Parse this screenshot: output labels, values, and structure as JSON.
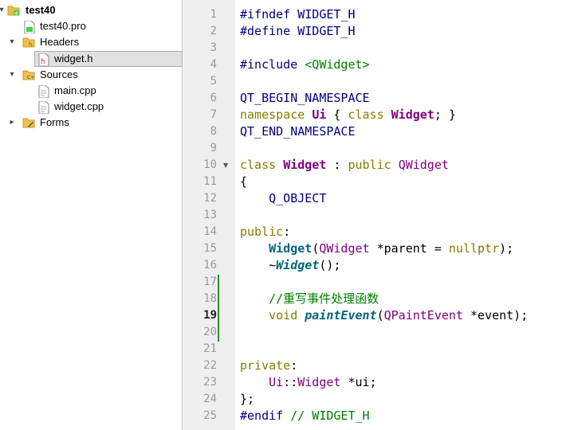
{
  "project_tree": {
    "root": {
      "label": "test40",
      "expanded": true
    },
    "items": [
      {
        "label": "test40.pro",
        "icon": "qt-project-file-icon"
      },
      {
        "label": "Headers",
        "icon": "headers-folder-icon",
        "expanded": true
      },
      {
        "label": "widget.h",
        "icon": "header-file-icon",
        "selected": true
      },
      {
        "label": "Sources",
        "icon": "sources-folder-icon",
        "expanded": true
      },
      {
        "label": "main.cpp",
        "icon": "cpp-file-icon"
      },
      {
        "label": "widget.cpp",
        "icon": "cpp-file-icon"
      },
      {
        "label": "Forms",
        "icon": "forms-folder-icon",
        "expanded": false
      }
    ]
  },
  "editor": {
    "current_line": 19,
    "folded_marker_line": 10,
    "lines": [
      {
        "n": "1",
        "tokens": [
          {
            "t": "#ifndef WIDGET_H",
            "c": "pre"
          }
        ]
      },
      {
        "n": "2",
        "tokens": [
          {
            "t": "#define WIDGET_H",
            "c": "pre"
          }
        ]
      },
      {
        "n": "3",
        "tokens": []
      },
      {
        "n": "4",
        "tokens": [
          {
            "t": "#include ",
            "c": "pre"
          },
          {
            "t": "<QWidget>",
            "c": "str"
          }
        ]
      },
      {
        "n": "5",
        "tokens": []
      },
      {
        "n": "6",
        "tokens": [
          {
            "t": "QT_BEGIN_NAMESPACE",
            "c": "mac"
          }
        ]
      },
      {
        "n": "7",
        "tokens": [
          {
            "t": "namespace",
            "c": "kw"
          },
          {
            "t": " ",
            "c": "txt"
          },
          {
            "t": "Ui",
            "c": "cls"
          },
          {
            "t": " { ",
            "c": "txt"
          },
          {
            "t": "class",
            "c": "kw"
          },
          {
            "t": " ",
            "c": "txt"
          },
          {
            "t": "Widget",
            "c": "cls"
          },
          {
            "t": "; }",
            "c": "txt"
          }
        ]
      },
      {
        "n": "8",
        "tokens": [
          {
            "t": "QT_END_NAMESPACE",
            "c": "mac"
          }
        ]
      },
      {
        "n": "9",
        "tokens": []
      },
      {
        "n": "10",
        "tokens": [
          {
            "t": "class",
            "c": "kw"
          },
          {
            "t": " ",
            "c": "txt"
          },
          {
            "t": "Widget",
            "c": "cls"
          },
          {
            "t": " : ",
            "c": "txt"
          },
          {
            "t": "public",
            "c": "kw"
          },
          {
            "t": " ",
            "c": "txt"
          },
          {
            "t": "QWidget",
            "c": "type"
          }
        ]
      },
      {
        "n": "11",
        "tokens": [
          {
            "t": "{",
            "c": "txt"
          }
        ]
      },
      {
        "n": "12",
        "tokens": [
          {
            "t": "    Q_OBJECT",
            "c": "mac"
          }
        ]
      },
      {
        "n": "13",
        "tokens": []
      },
      {
        "n": "14",
        "tokens": [
          {
            "t": "public",
            "c": "kw"
          },
          {
            "t": ":",
            "c": "txt"
          }
        ]
      },
      {
        "n": "15",
        "tokens": [
          {
            "t": "    ",
            "c": "txt"
          },
          {
            "t": "Widget",
            "c": "fn"
          },
          {
            "t": "(",
            "c": "txt"
          },
          {
            "t": "QWidget",
            "c": "type"
          },
          {
            "t": " *parent = ",
            "c": "txt"
          },
          {
            "t": "nullptr",
            "c": "kw"
          },
          {
            "t": ");",
            "c": "txt"
          }
        ]
      },
      {
        "n": "16",
        "tokens": [
          {
            "t": "    ~",
            "c": "txt"
          },
          {
            "t": "Widget",
            "c": "fni"
          },
          {
            "t": "();",
            "c": "txt"
          }
        ]
      },
      {
        "n": "17",
        "tokens": []
      },
      {
        "n": "18",
        "tokens": [
          {
            "t": "    //重写事件处理函数",
            "c": "cmt"
          }
        ]
      },
      {
        "n": "19",
        "tokens": [
          {
            "t": "    ",
            "c": "txt"
          },
          {
            "t": "void",
            "c": "kw"
          },
          {
            "t": " ",
            "c": "txt"
          },
          {
            "t": "paintEvent",
            "c": "fni"
          },
          {
            "t": "(",
            "c": "txt"
          },
          {
            "t": "QPaintEvent",
            "c": "type"
          },
          {
            "t": " *event);",
            "c": "txt"
          }
        ]
      },
      {
        "n": "20",
        "tokens": []
      },
      {
        "n": "21",
        "tokens": []
      },
      {
        "n": "22",
        "tokens": [
          {
            "t": "private",
            "c": "kw"
          },
          {
            "t": ":",
            "c": "txt"
          }
        ]
      },
      {
        "n": "23",
        "tokens": [
          {
            "t": "    ",
            "c": "txt"
          },
          {
            "t": "Ui",
            "c": "type"
          },
          {
            "t": "::",
            "c": "txt"
          },
          {
            "t": "Widget",
            "c": "type"
          },
          {
            "t": " *ui;",
            "c": "txt"
          }
        ]
      },
      {
        "n": "24",
        "tokens": [
          {
            "t": "};",
            "c": "txt"
          }
        ]
      },
      {
        "n": "25",
        "tokens": [
          {
            "t": "#endif",
            "c": "pre"
          },
          {
            "t": " // WIDGET_H",
            "c": "cmt"
          }
        ]
      }
    ]
  }
}
